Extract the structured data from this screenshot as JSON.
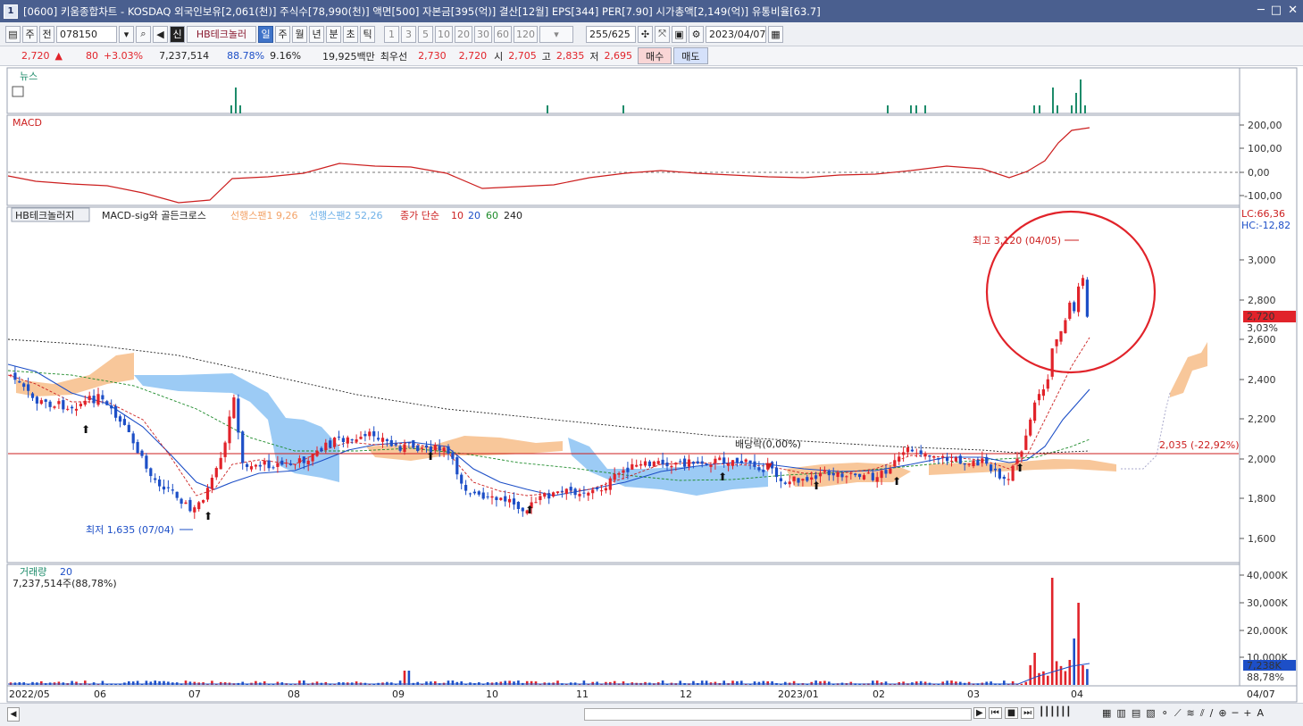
{
  "window": {
    "screen_no": "1",
    "title": "[0600] 키움종합차트 - KOSDAQ 외국인보유[2,061(천)] 주식수[78,990(천)] 액면[500] 자본금[395(억)] 결산[12월] EPS[344] PER[7.90] 시가총액[2,149(억)] 유통비율[63.7]",
    "window_controls": [
      "─",
      "□",
      "✕"
    ]
  },
  "toolbar": {
    "mode_select": "주",
    "range_select": "전",
    "code_input": "078150",
    "stock_badge": "신",
    "stock_name": "HB테크놀러",
    "periods": [
      "일",
      "주",
      "월",
      "년",
      "분",
      "초",
      "틱"
    ],
    "active_period": "일",
    "intervals": [
      "1",
      "3",
      "5",
      "10",
      "20",
      "30",
      "60",
      "120"
    ],
    "count_display": "255/625",
    "date_input": "2023/04/07"
  },
  "quote": {
    "price": "2,720",
    "arrow": "▲",
    "change": "80",
    "change_pct": "+3.03%",
    "volume": "7,237,514",
    "ratio1": "88.78%",
    "ratio2": "9.16%",
    "amount": "19,925백만",
    "best_label": "최우선",
    "best_ask": "2,730",
    "best_bid": "2,720",
    "open_label": "시",
    "open": "2,705",
    "high_label": "고",
    "high": "2,835",
    "low_label": "저",
    "low": "2,695",
    "buy_btn": "매수",
    "sell_btn": "매도"
  },
  "panels": {
    "news_label": "뉴스",
    "macd_label": "MACD",
    "macd_axis": [
      "200,00",
      "100,00",
      "0,00",
      "-100,00"
    ],
    "main_title": "HB테크놀러지",
    "main_indicator": "MACD-sig와 골든크로스",
    "span1": "선행스팬1 9,26",
    "span2": "선행스팬2 52,26",
    "ma_label": "종가 단순",
    "ma_periods": [
      "10",
      "20",
      "60",
      "240"
    ],
    "lc": "LC:66,36",
    "hc": "HC:-12,82",
    "price_axis": [
      "3,000",
      "2,800",
      "2,600",
      "2,400",
      "2,200",
      "2,000",
      "1,800",
      "1,600"
    ],
    "current_price_tag": "2,720",
    "current_pct_tag": "3,03%",
    "high_annotation": "최고 3,120 (04/05)",
    "low_annotation": "최저 1,635 (07/04)",
    "dividend_annotation": "배당락(0,00%)",
    "line_annotation": "2,035 (-22,92%)",
    "volume_label": "거래량",
    "volume_period": "20",
    "volume_info": "7,237,514주(88,78%)",
    "volume_axis": [
      "40,000K",
      "30,000K",
      "20,000K",
      "10,000K"
    ],
    "volume_tag": "7,238K",
    "volume_pct_tag": "88,78%",
    "date_axis": [
      "2022/05",
      "06",
      "07",
      "08",
      "09",
      "10",
      "11",
      "12",
      "2023/01",
      "02",
      "03",
      "04"
    ],
    "date_axis_right": "04/07"
  },
  "colors": {
    "up": "#e1232a",
    "down": "#1d4fc7",
    "cloud_pos": "#f8c79a",
    "cloud_neg": "#9ccbf5",
    "macd": "#cc1f1f",
    "highlight_circle": "#e1232a"
  }
}
